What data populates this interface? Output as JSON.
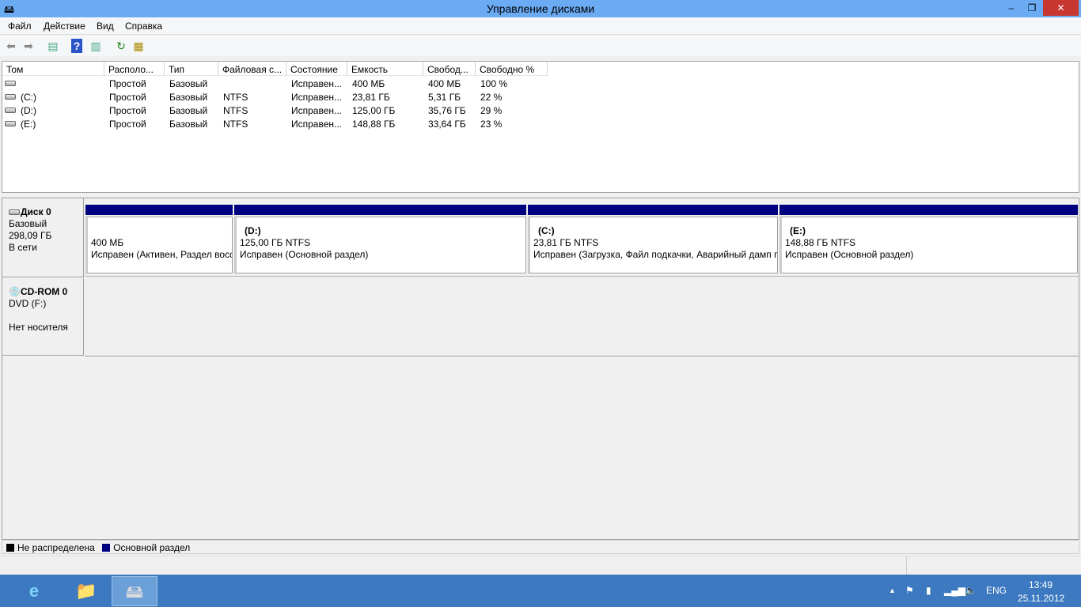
{
  "window": {
    "title": "Управление дисками",
    "minimize": "–",
    "maximize": "❐",
    "close": "✕"
  },
  "menu": [
    "Файл",
    "Действие",
    "Вид",
    "Справка"
  ],
  "columns": [
    "Том",
    "Располо...",
    "Тип",
    "Файловая с...",
    "Состояние",
    "Емкость",
    "Свобод...",
    "Свободно %"
  ],
  "volumes": [
    [
      "",
      "Простой",
      "Базовый",
      "",
      "Исправен...",
      "400 МБ",
      "400 МБ",
      "100 %"
    ],
    [
      "(C:)",
      "Простой",
      "Базовый",
      "NTFS",
      "Исправен...",
      "23,81 ГБ",
      "5,31 ГБ",
      "22 %"
    ],
    [
      "(D:)",
      "Простой",
      "Базовый",
      "NTFS",
      "Исправен...",
      "125,00 ГБ",
      "35,76 ГБ",
      "29 %"
    ],
    [
      "(E:)",
      "Простой",
      "Базовый",
      "NTFS",
      "Исправен...",
      "148,88 ГБ",
      "33,64 ГБ",
      "23 %"
    ]
  ],
  "disk0": {
    "name": "Диск 0",
    "type": "Базовый",
    "size": "298,09 ГБ",
    "status": "В сети",
    "partitions": [
      {
        "name": "",
        "size": "400 МБ",
        "status": "Исправен (Активен, Раздел восстановления)"
      },
      {
        "name": "(D:)",
        "size": "125,00 ГБ NTFS",
        "status": "Исправен (Основной раздел)"
      },
      {
        "name": "(C:)",
        "size": "23,81 ГБ NTFS",
        "status": "Исправен (Загрузка, Файл подкачки, Аварийный дамп памяти, Основной раздел)"
      },
      {
        "name": "(E:)",
        "size": "148,88 ГБ NTFS",
        "status": "Исправен (Основной раздел)"
      }
    ]
  },
  "cdrom": {
    "name": "CD-ROM 0",
    "type": "DVD (F:)",
    "status": "Нет носителя"
  },
  "legend": [
    {
      "label": "Не распределена",
      "color": "#000000"
    },
    {
      "label": "Основной раздел",
      "color": "#000080"
    }
  ],
  "tray": {
    "lang": "ENG",
    "time": "13:49",
    "date": "25.11.2012"
  }
}
